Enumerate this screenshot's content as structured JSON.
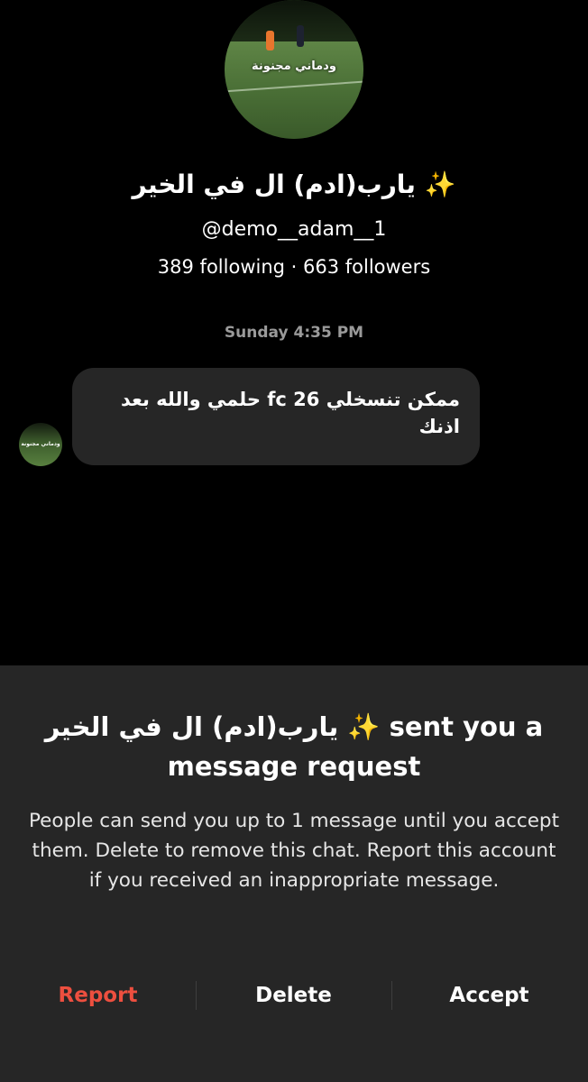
{
  "profile": {
    "avatar_overlay_text": "ودماني مجنونة",
    "display_name": "يارب(ادم) ال في الخير ✨",
    "username": "@demo__adam__1",
    "stats": "389 following · 663 followers"
  },
  "conversation": {
    "timestamp": "Sunday 4:35 PM",
    "messages": [
      {
        "sender": "other",
        "text": "ممكن تنسخلي fc 26 حلمي والله بعد اذنك"
      }
    ]
  },
  "request_sheet": {
    "title": "يارب(ادم) ال في الخير ✨ sent you a message request",
    "body": "People can send you up to 1 message until you accept them. Delete to remove this chat. Report this account if you received an inappropriate message.",
    "actions": {
      "report": "Report",
      "delete": "Delete",
      "accept": "Accept"
    }
  },
  "colors": {
    "background": "#000000",
    "sheet": "#262626",
    "bubble": "#262626",
    "report": "#ed4f3f",
    "timestamp": "#9a9a9a"
  }
}
